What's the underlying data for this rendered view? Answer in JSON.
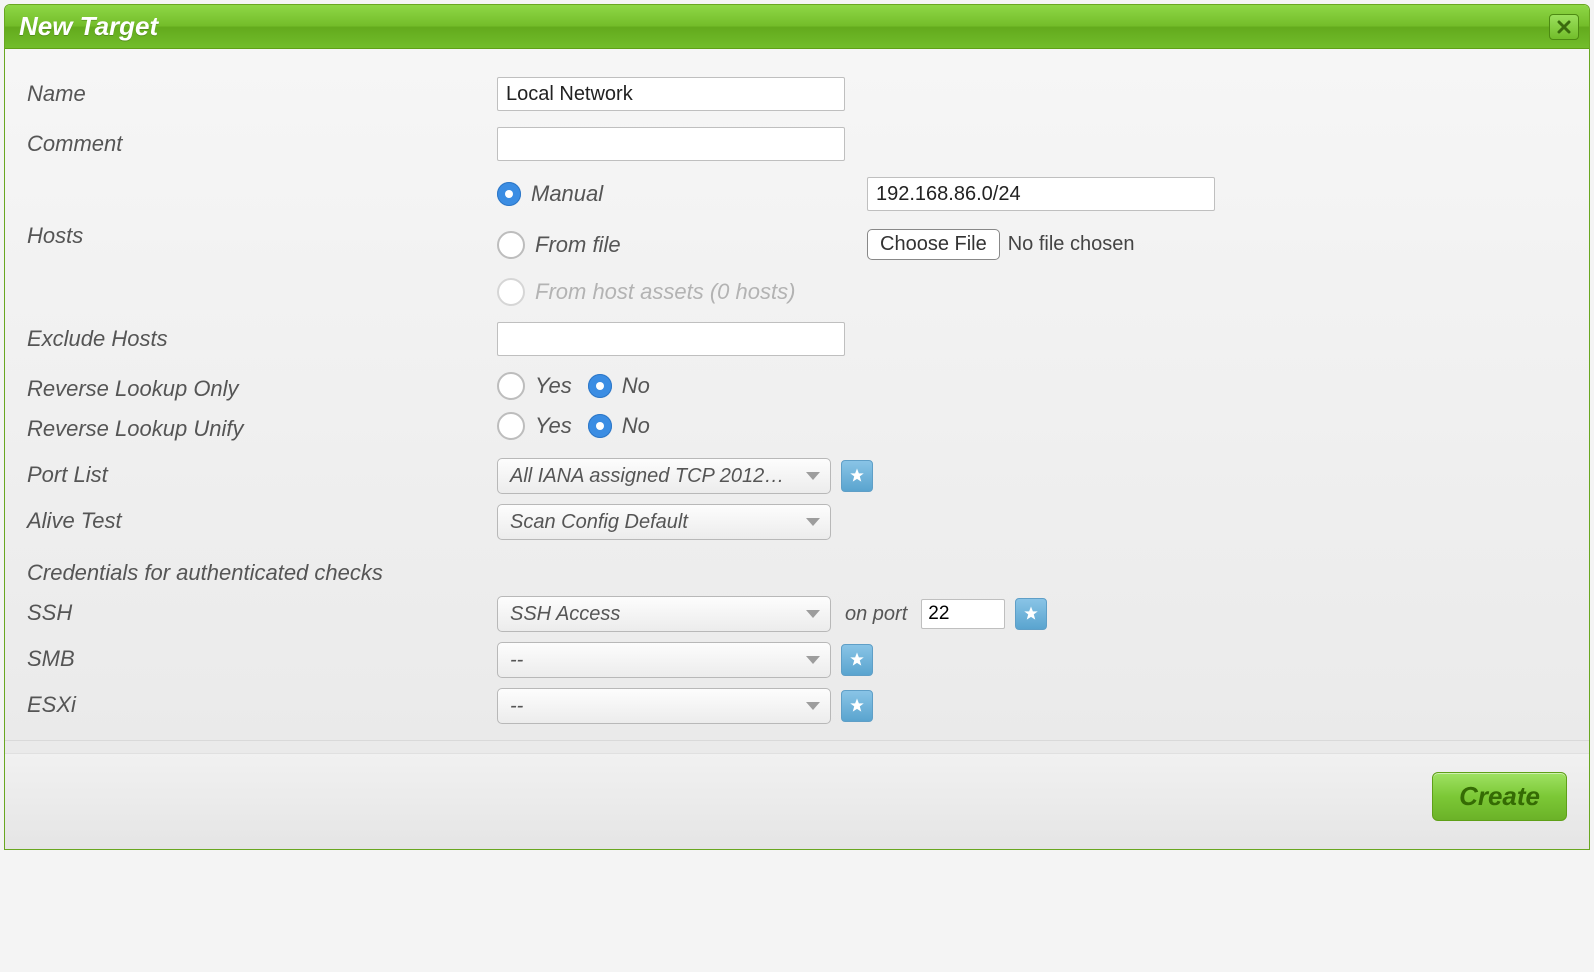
{
  "colors": {
    "accent_green": "#72bd2b",
    "accent_blue": "#3b8de3",
    "star_blue": "#5aa4cf"
  },
  "title": "New Target",
  "labels": {
    "name": "Name",
    "comment": "Comment",
    "hosts": "Hosts",
    "exclude_hosts": "Exclude Hosts",
    "reverse_lookup_only": "Reverse Lookup Only",
    "reverse_lookup_unify": "Reverse Lookup Unify",
    "port_list": "Port List",
    "alive_test": "Alive Test",
    "credentials_header": "Credentials for authenticated checks",
    "ssh": "SSH",
    "smb": "SMB",
    "esxi": "ESXi",
    "yes": "Yes",
    "no": "No",
    "on_port": "on port"
  },
  "fields": {
    "name_value": "Local Network",
    "comment_value": "",
    "hosts_mode": "manual",
    "hosts_manual_label": "Manual",
    "hosts_fromfile_label": "From file",
    "hosts_assets_label": "From host assets (0 hosts)",
    "hosts_manual_value": "192.168.86.0/24",
    "choose_file_label": "Choose File",
    "no_file_chosen": "No file chosen",
    "exclude_hosts_value": "",
    "reverse_lookup_only": "no",
    "reverse_lookup_unify": "no",
    "port_list_selected": "All IANA assigned TCP 2012…",
    "alive_test_selected": "Scan Config Default",
    "ssh_credential": "SSH Access",
    "ssh_port": "22",
    "smb_credential": "--",
    "esxi_credential": "--"
  },
  "actions": {
    "create": "Create"
  }
}
